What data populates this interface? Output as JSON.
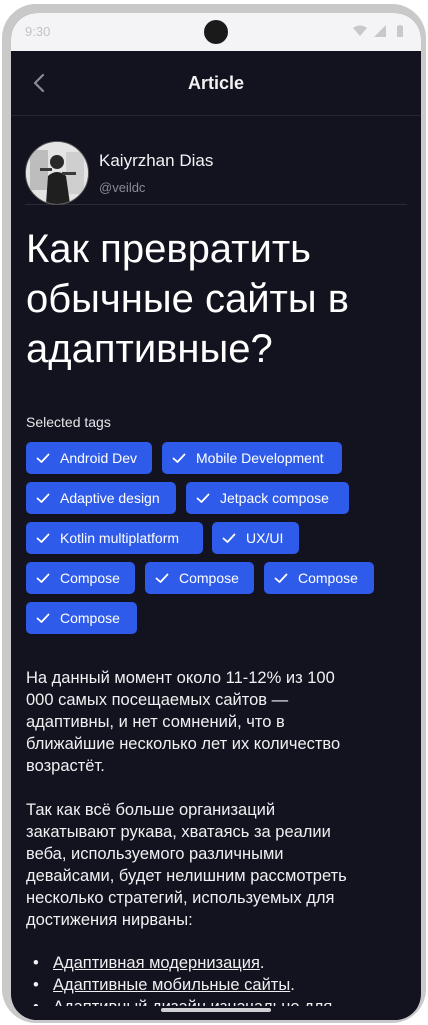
{
  "status_bar": {
    "time": "9:30",
    "icons": [
      "wifi-icon",
      "signal-icon",
      "battery-icon"
    ]
  },
  "app_bar": {
    "title": "Article",
    "back_icon": "chevron-left-icon"
  },
  "author": {
    "name": "Kaiyrzhan Dias",
    "handle": "@veildc",
    "avatar": "avatar-photo"
  },
  "article": {
    "title_lines": [
      "Как превратить",
      "обычные сайты в",
      "адаптивные?"
    ],
    "tags_label": "Selected tags",
    "tags": [
      "Android Dev",
      "Mobile Development",
      "Adaptive design",
      "Jetpack compose",
      "Kotlin multiplatform",
      "UX/UI",
      "Compose",
      "Compose",
      "Compose",
      "Compose"
    ],
    "paragraph1": [
      "На данный момент около 11-12% из 100",
      "000 самых посещаемых сайтов —",
      "адаптивны, и нет сомнений, что в",
      "ближайшие несколько лет их количество",
      "возрастёт."
    ],
    "paragraph2": [
      "Так как всё больше организаций",
      "закатывают рукава, хватаясь за реалии",
      "веба, используемого различными",
      "девайсами, будет нелишним рассмотреть",
      "несколько стратегий, используемых для",
      "достижения нирваны:"
    ],
    "list": [
      {
        "link": "Адаптивная модернизация",
        "suffix": "."
      },
      {
        "link": "Адаптивные мобильные сайты",
        "suffix": "."
      },
      {
        "link": "Адаптивный дизайн изначально для",
        "suffix": ""
      }
    ]
  },
  "colors": {
    "background": "#13131f",
    "chip": "#2f5bea",
    "text": "#f0f0f2"
  }
}
